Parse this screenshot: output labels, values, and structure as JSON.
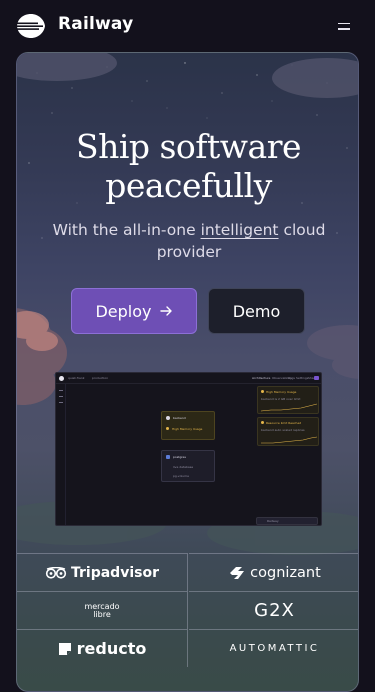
{
  "header": {
    "brand": "Railway",
    "logo_icon": "railway-logo-icon",
    "menu_icon": "hamburger-menu-icon"
  },
  "hero": {
    "title_line1": "Ship software",
    "title_line2": "peacefully",
    "subtitle_prefix": "With the all-in-one ",
    "subtitle_link": "intelligent",
    "subtitle_suffix": " cloud provider",
    "deploy_label": "Deploy",
    "deploy_icon": "arrow-right-icon",
    "demo_label": "Demo"
  },
  "preview": {
    "project_name": "quiet-frank",
    "environment": "production",
    "tabs": [
      "Architecture",
      "Observability",
      "Logs",
      "Settings",
      "Share"
    ],
    "service_card_1": {
      "title": "backend",
      "status": "High Memory Usage"
    },
    "service_card_2": {
      "title": "postgres",
      "line1": "live database",
      "line2": "pg-volume"
    },
    "alert_1": {
      "title": "High Memory Usage",
      "body": "backend is 2 GB over limit"
    },
    "alert_2": {
      "title": "Resource limit Reached",
      "body": "backend auto scaled replicas"
    },
    "bottom_button": "Railway"
  },
  "partners": [
    {
      "name": "Tripadvisor",
      "icon": "tripadvisor-owl-icon"
    },
    {
      "name": "cognizant",
      "icon": "cognizant-icon"
    },
    {
      "name_line1": "mercado",
      "name_line2": "libre"
    },
    {
      "name": "G2X"
    },
    {
      "name": "reducto",
      "icon": "reducto-icon"
    },
    {
      "name": "AUTOMATTIC"
    }
  ],
  "colors": {
    "background": "#13111c",
    "deploy_button": "#6e4fb5",
    "demo_button": "#1d1f2b",
    "alert_accent": "#e4b64a"
  }
}
